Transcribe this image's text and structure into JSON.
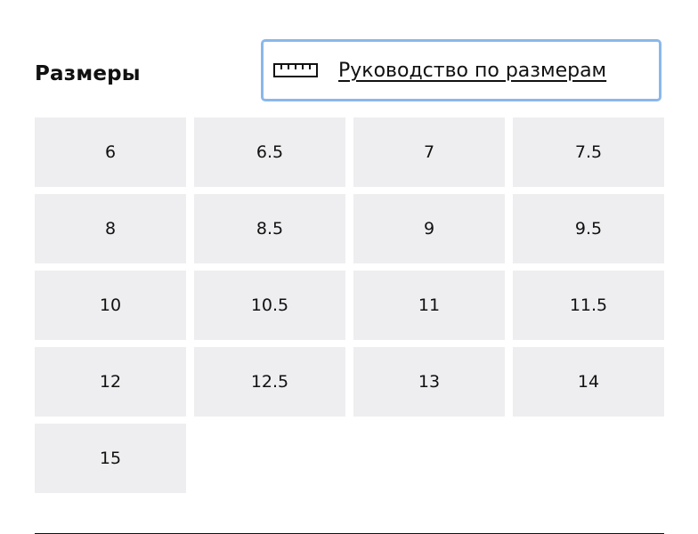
{
  "header": {
    "title": "Размеры",
    "size_guide_label": "Руководство по размерам",
    "size_guide_icon": "ruler-icon",
    "focus_color": "#8ab8ea"
  },
  "sizes": [
    "6",
    "6.5",
    "7",
    "7.5",
    "8",
    "8.5",
    "9",
    "9.5",
    "10",
    "10.5",
    "11",
    "11.5",
    "12",
    "12.5",
    "13",
    "14",
    "15"
  ],
  "colors": {
    "cell_background": "#eeeef0",
    "text": "#111111"
  }
}
